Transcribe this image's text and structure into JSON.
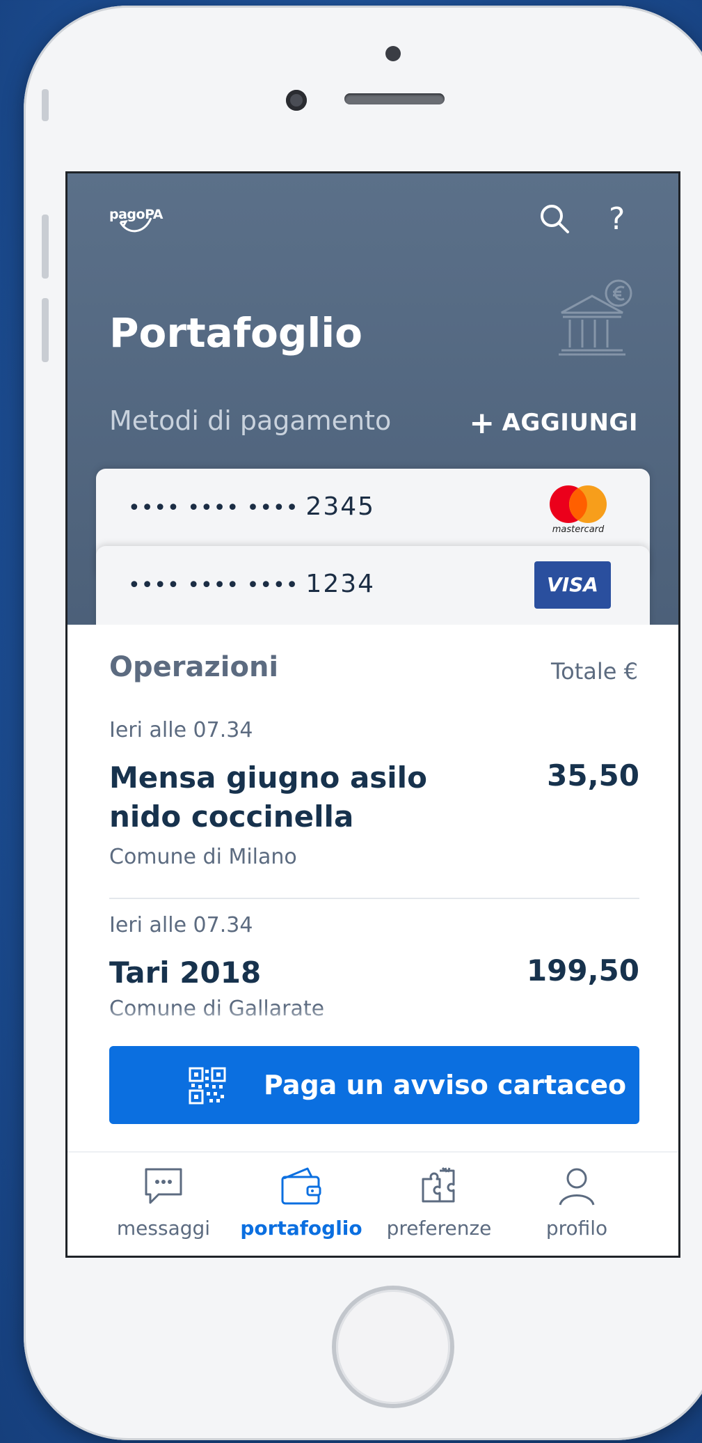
{
  "app": {
    "logo_text": "pagoPA",
    "title": "Portafoglio"
  },
  "header": {
    "search_icon": "search-icon",
    "help_label": "?",
    "bank_icon": "bank-euro-icon",
    "payment_methods_label": "Metodi di pagamento",
    "add_label": "AGGIUNGI"
  },
  "cards": [
    {
      "dots": "•••• •••• ••••",
      "last4": "2345",
      "brand": "mastercard"
    },
    {
      "dots": "•••• •••• ••••",
      "last4": "1234",
      "brand": "VISA"
    }
  ],
  "operations": {
    "title": "Operazioni",
    "total_label": "Totale €",
    "items": [
      {
        "date": "Ieri alle 07.34",
        "name": "Mensa giugno asilo nido coccinella",
        "amount": "35,50",
        "org": "Comune di Milano"
      },
      {
        "date": "Ieri alle 07.34",
        "name": "Tari 2018",
        "amount": "199,50",
        "org": "Comune di Gallarate"
      }
    ]
  },
  "pay_button": {
    "label": "Paga un avviso cartaceo",
    "icon": "qr-code-icon"
  },
  "tabs": [
    {
      "label": "messaggi",
      "icon": "message-icon",
      "active": false
    },
    {
      "label": "portafoglio",
      "icon": "wallet-icon",
      "active": true
    },
    {
      "label": "preferenze",
      "icon": "puzzle-icon",
      "active": false
    },
    {
      "label": "profilo",
      "icon": "user-icon",
      "active": false
    }
  ],
  "colors": {
    "header_bg": "#5b7089",
    "primary": "#0b6fe0",
    "text_dark": "#17324d",
    "text_muted": "#5c6b80"
  }
}
